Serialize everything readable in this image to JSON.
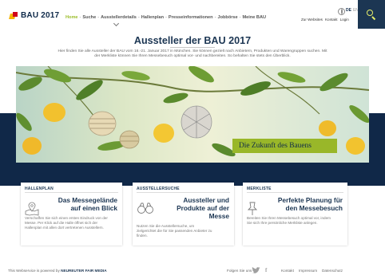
{
  "brand": {
    "logo_text": "BAU 2017"
  },
  "nav": {
    "items": [
      "Home",
      "Suche",
      "Ausstellerdetails",
      "Hallenplan",
      "Presseinformationen",
      "Jobbörse",
      "Meine BAU"
    ],
    "active": "Home",
    "separator": "-"
  },
  "lang": {
    "de": "DE",
    "en": "EN"
  },
  "toplinks": {
    "watchlist": "Zur Websites",
    "contact": "Kontakt",
    "login": "Login"
  },
  "search": {
    "icon": "search-icon"
  },
  "page": {
    "title": "Aussteller der BAU 2017",
    "intro": "Hier finden Sie alle Aussteller der BAU vom 16.-21. Januar 2017 in München. Sie können gezielt nach Anbietern, Produkten und Warengruppen suchen. Mit der Merkliste können Sie Ihren Messebesuch optimal vor- und nachbereiten. So behalten Sie stets den Überblick."
  },
  "hero": {
    "tagline": "Die Zukunft des Bauens"
  },
  "cards": [
    {
      "category": "HALLENPLAN",
      "headline_1": "Das Messegelände",
      "headline_2": "auf einen Blick",
      "text": "Verschaffen Sie sich einen ersten Eindruck von der Messe. Per Klick auf die Halle öffnet sich der Hallenplan mit allen dort vertretenen Ausstellern.",
      "icon": "map-pin-icon"
    },
    {
      "category": "AUSSTELLERSUCHE",
      "headline_1": "Aussteller und",
      "headline_2": "Produkte auf der",
      "headline_3": "Messe",
      "text": "Nutzen Sie die Ausstellersuche, um zielgerichtet die für Sie passenden Anbieter zu finden.",
      "icon": "binoculars-icon"
    },
    {
      "category": "MERKLISTE",
      "headline_1": "Perfekte Planung für",
      "headline_2": "den Messebesuch",
      "text": "Bereiten Sie Ihren Messebesuch optimal vor, indem Sie sich Ihre persönliche Merkliste anlegen.",
      "icon": "pushpin-icon"
    }
  ],
  "footer": {
    "powered_prefix": "This Webservice is powered by",
    "powered_brand": "NEUREUTER FAIR MEDIA",
    "follow": "Folgen Sie uns",
    "facebook": "f",
    "links": [
      "Kontakt",
      "Impressum",
      "Datenschutz"
    ]
  },
  "colors": {
    "navy": "#1c3653",
    "band": "#102848",
    "accent_green": "#99b729",
    "nav_active": "#9bbd2a"
  }
}
